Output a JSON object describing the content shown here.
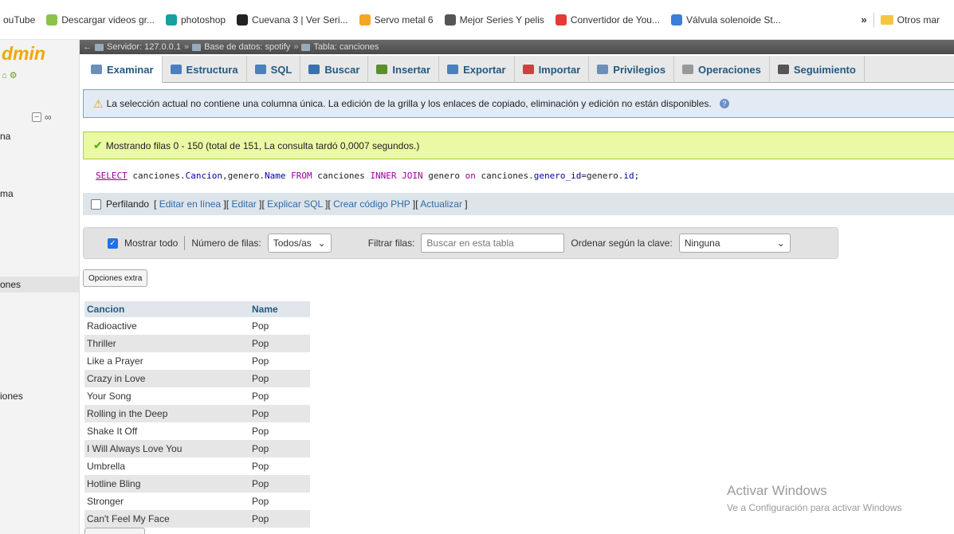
{
  "bookmarks": [
    {
      "label": "ouTube",
      "icon": "youtube-icon",
      "color": "#ffffff"
    },
    {
      "label": "Descargar videos gr...",
      "icon": "download-leaf-icon",
      "color": "#8bc34a"
    },
    {
      "label": "photoshop",
      "icon": "photoshop-icon",
      "color": "#18a0a0"
    },
    {
      "label": "Cuevana 3 | Ver Seri...",
      "icon": "cuevana-icon",
      "color": "#222222"
    },
    {
      "label": "Servo metal 6",
      "icon": "amazon-icon",
      "color": "#f5a623"
    },
    {
      "label": "Mejor Series Y pelis",
      "icon": "camera-icon",
      "color": "#555555"
    },
    {
      "label": "Convertidor de You...",
      "icon": "convert-icon",
      "color": "#e53935"
    },
    {
      "label": "Válvula solenoide St...",
      "icon": "valve-icon",
      "color": "#3b7dd8"
    }
  ],
  "bookmarks_more": "»",
  "bookmarks_other": "Otros mar",
  "leftnav": {
    "logo": "dmin",
    "items": [
      {
        "label": "na"
      },
      {
        "label": "ma"
      },
      {
        "label": "ones"
      },
      {
        "label": "iones"
      }
    ]
  },
  "breadcrumb": {
    "server": "Servidor: 127.0.0.1",
    "database": "Base de datos: spotify",
    "table": "Tabla: canciones",
    "sep": "»"
  },
  "tabs": [
    {
      "label": "Examinar",
      "icon": "browse-icon",
      "active": true
    },
    {
      "label": "Estructura",
      "icon": "structure-icon"
    },
    {
      "label": "SQL",
      "icon": "sql-icon"
    },
    {
      "label": "Buscar",
      "icon": "search-icon"
    },
    {
      "label": "Insertar",
      "icon": "insert-icon"
    },
    {
      "label": "Exportar",
      "icon": "export-icon"
    },
    {
      "label": "Importar",
      "icon": "import-icon"
    },
    {
      "label": "Privilegios",
      "icon": "privileges-icon"
    },
    {
      "label": "Operaciones",
      "icon": "operations-icon"
    },
    {
      "label": "Seguimiento",
      "icon": "tracking-icon"
    }
  ],
  "notice": "La selección actual no contiene una columna única. La edición de la grilla y los enlaces de copiado, eliminación y edición no están disponibles.",
  "success": "Mostrando filas 0 - 150 (total de 151, La consulta tardó 0,0007 segundos.)",
  "sql": {
    "select": "SELECT",
    "part1": " canciones.",
    "f1": "Cancion",
    "part2": ",genero.",
    "f2": "Name",
    "from": " FROM",
    "part3": " canciones ",
    "join": "INNER JOIN",
    "part4": " genero ",
    "on": "on",
    "part5": " canciones.",
    "f3": "genero_id",
    "part6": "=genero.",
    "f4": "id",
    "part7": ";"
  },
  "profiling": {
    "label": "Perfilando",
    "links": [
      "Editar en línea",
      "Editar",
      "Explicar SQL",
      "Crear código PHP",
      "Actualizar"
    ]
  },
  "filter": {
    "show_all": "Mostrar todo",
    "rows_label": "Número de filas:",
    "rows_value": "Todos/as",
    "filter_label": "Filtrar filas:",
    "filter_placeholder": "Buscar en esta tabla",
    "sort_label": "Ordenar según la clave:",
    "sort_value": "Ninguna"
  },
  "extra_options": "Opciones extra",
  "table": {
    "columns": [
      "Cancion",
      "Name"
    ],
    "rows": [
      [
        "Radioactive",
        "Pop"
      ],
      [
        "Thriller",
        "Pop"
      ],
      [
        "Like a Prayer",
        "Pop"
      ],
      [
        "Crazy in Love",
        "Pop"
      ],
      [
        "Your Song",
        "Pop"
      ],
      [
        "Rolling in the Deep",
        "Pop"
      ],
      [
        "Shake It Off",
        "Pop"
      ],
      [
        "I Will Always Love You",
        "Pop"
      ],
      [
        "Umbrella",
        "Pop"
      ],
      [
        "Hotline Bling",
        "Pop"
      ],
      [
        "Stronger",
        "Pop"
      ],
      [
        "Can't Feel My Face",
        "Pop"
      ]
    ]
  },
  "watermark": {
    "title": "Activar Windows",
    "subtitle": "Ve a Configuración para activar Windows"
  }
}
